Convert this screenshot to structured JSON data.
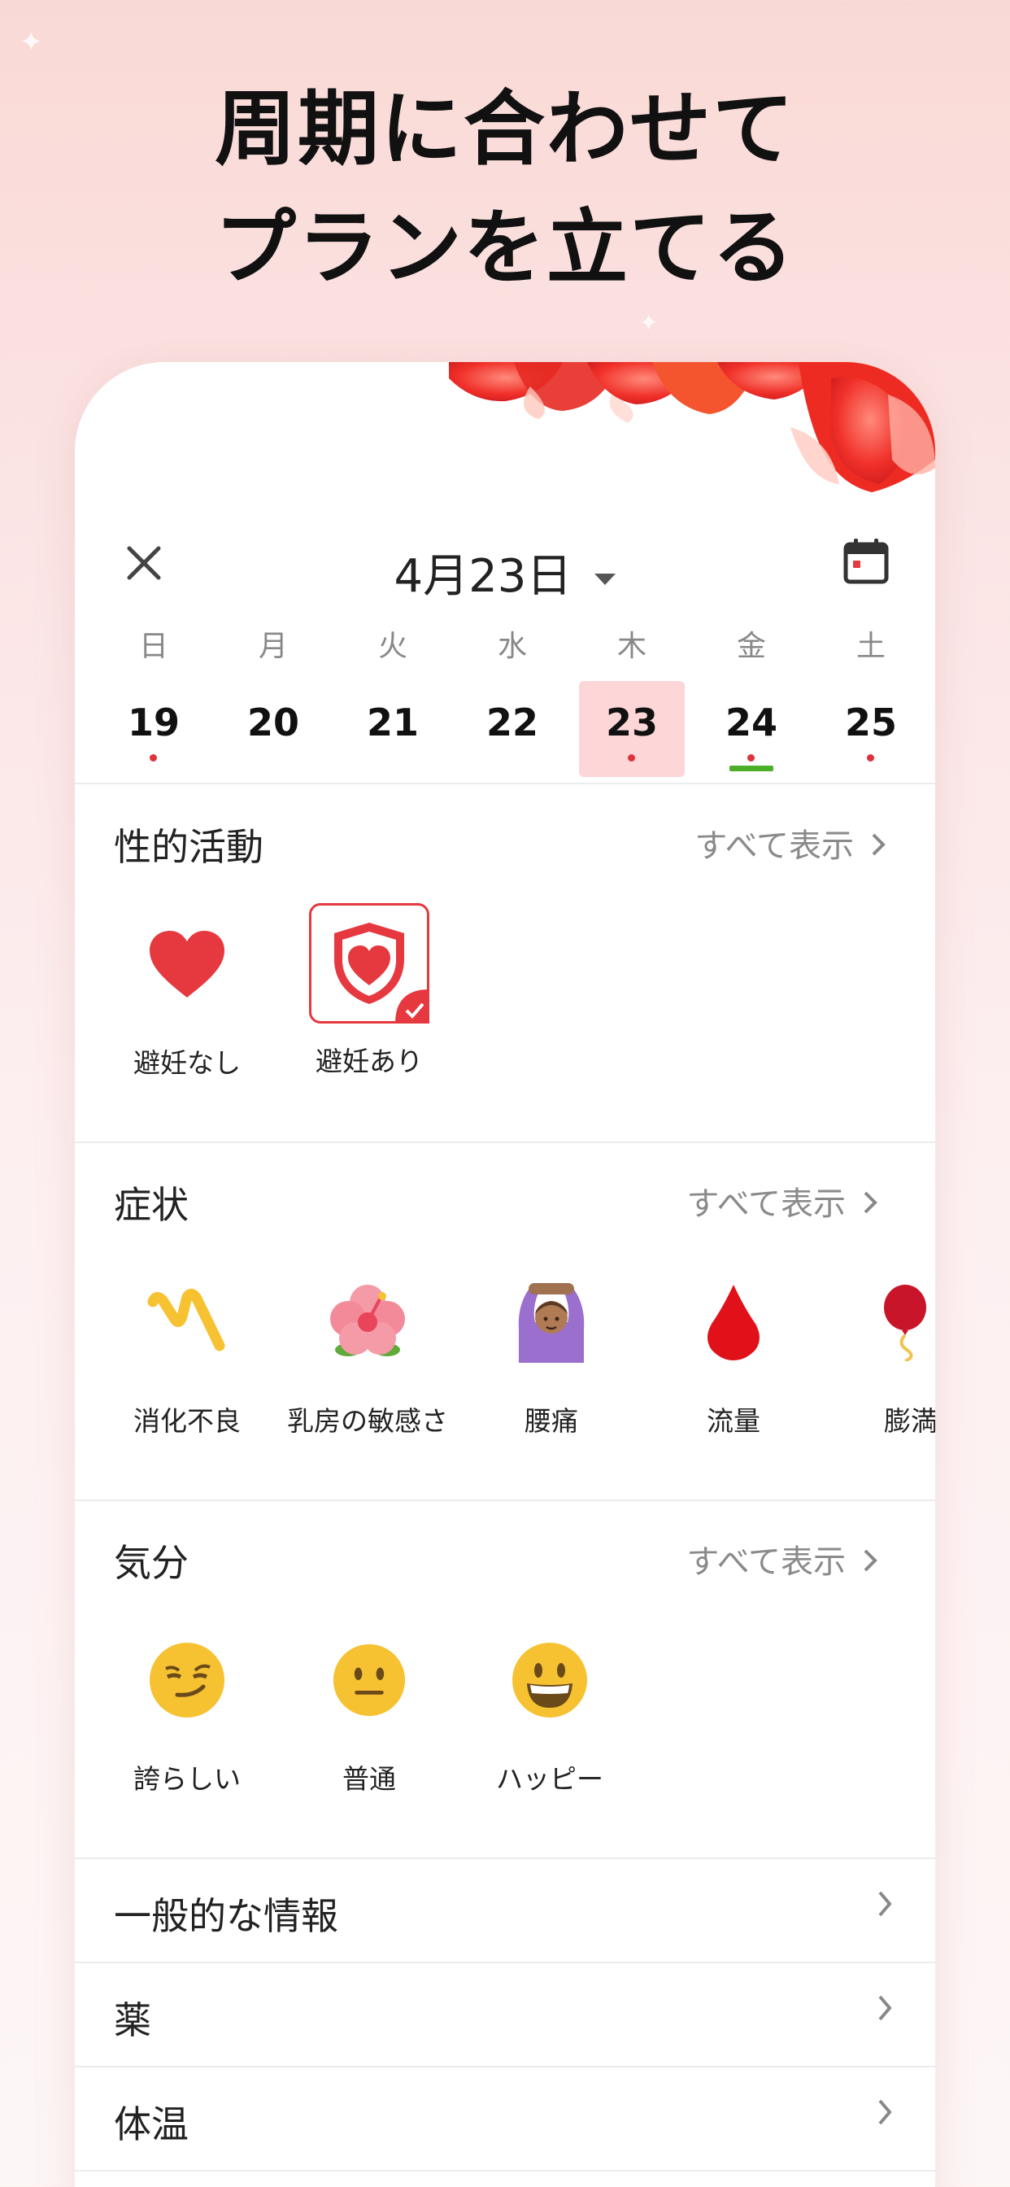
{
  "headline": {
    "line1": "周期に合わせて",
    "line2": "プランを立てる"
  },
  "topbar": {
    "date": "4月23日"
  },
  "week": [
    {
      "dow": "日",
      "num": "19",
      "dot": true,
      "selected": false,
      "underline": false
    },
    {
      "dow": "月",
      "num": "20",
      "dot": false,
      "selected": false,
      "underline": false
    },
    {
      "dow": "火",
      "num": "21",
      "dot": false,
      "selected": false,
      "underline": false
    },
    {
      "dow": "水",
      "num": "22",
      "dot": false,
      "selected": false,
      "underline": false
    },
    {
      "dow": "木",
      "num": "23",
      "dot": true,
      "selected": true,
      "underline": false
    },
    {
      "dow": "金",
      "num": "24",
      "dot": true,
      "selected": false,
      "underline": true
    },
    {
      "dow": "土",
      "num": "25",
      "dot": true,
      "selected": false,
      "underline": false
    }
  ],
  "sexual_activity": {
    "title": "性的活動",
    "see_all": "すべて表示",
    "items": [
      {
        "label": "避妊なし",
        "icon": "heart-icon"
      },
      {
        "label": "避妊あり",
        "icon": "shield-heart-icon",
        "checked": true
      }
    ]
  },
  "symptoms": {
    "title": "症状",
    "see_all": "すべて表示",
    "items": [
      {
        "label": "消化不良",
        "icon": "indigestion-icon"
      },
      {
        "label": "乳房の敏感さ",
        "icon": "hibiscus-icon"
      },
      {
        "label": "腰痛",
        "icon": "person-arms-up-icon"
      },
      {
        "label": "流量",
        "icon": "blood-drop-icon"
      },
      {
        "label": "膨満",
        "icon": "balloon-icon"
      }
    ]
  },
  "mood": {
    "title": "気分",
    "see_all": "すべて表示",
    "items": [
      {
        "label": "誇らしい",
        "icon": "smirk-face-icon"
      },
      {
        "label": "普通",
        "icon": "neutral-face-icon"
      },
      {
        "label": "ハッピー",
        "icon": "grin-face-icon"
      }
    ]
  },
  "rows": [
    {
      "label": "一般的な情報"
    },
    {
      "label": "薬"
    },
    {
      "label": "体温"
    }
  ],
  "colors": {
    "accent": "#e5393f",
    "selected_day_bg": "#fdd6d8",
    "underline": "#4caf2a"
  }
}
